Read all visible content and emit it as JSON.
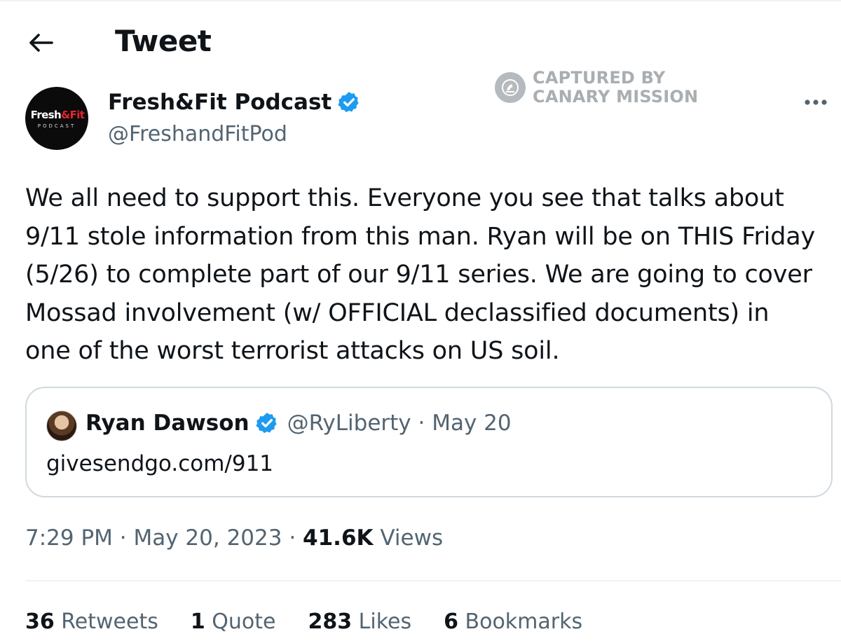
{
  "header": {
    "title": "Tweet",
    "back_icon": "arrow-left-icon"
  },
  "watermark": {
    "line1": "CAPTURED BY",
    "line2": "CANARY MISSION",
    "icon": "canary-bird-icon"
  },
  "author": {
    "name": "Fresh&Fit Podcast",
    "handle": "@FreshandFitPod",
    "avatar_logo_white": "Fresh",
    "avatar_logo_red": "&Fit",
    "avatar_logo_sub": "PODCAST",
    "verified_color": "#1d9bf0"
  },
  "tweet": {
    "lines": [
      "We all need to support this. Everyone you see that talks about",
      "9/11 stole information from this man. Ryan will be on THIS Friday",
      "(5/26) to complete part of our 9/11 series. We are going to cover",
      "Mossad involvement (w/ OFFICIAL declassified documents) in",
      "one of the worst terrorist attacks on US soil."
    ]
  },
  "quote": {
    "name": "Ryan Dawson",
    "handle_date": "@RyLiberty · May 20",
    "text": "givesendgo.com/911"
  },
  "meta": {
    "time_date": "7:29 PM · May 20, 2023 · ",
    "views_count": "41.6K",
    "views_label": " Views"
  },
  "stats": {
    "retweets": {
      "count": "36",
      "label": " Retweets"
    },
    "quotes": {
      "count": "1",
      "label": " Quote"
    },
    "likes": {
      "count": "283",
      "label": " Likes"
    },
    "bookmarks": {
      "count": "6",
      "label": " Bookmarks"
    }
  },
  "colors": {
    "text": "#0f1419",
    "secondary": "#536471",
    "accent": "#1d9bf0",
    "border": "#cfd9de"
  }
}
